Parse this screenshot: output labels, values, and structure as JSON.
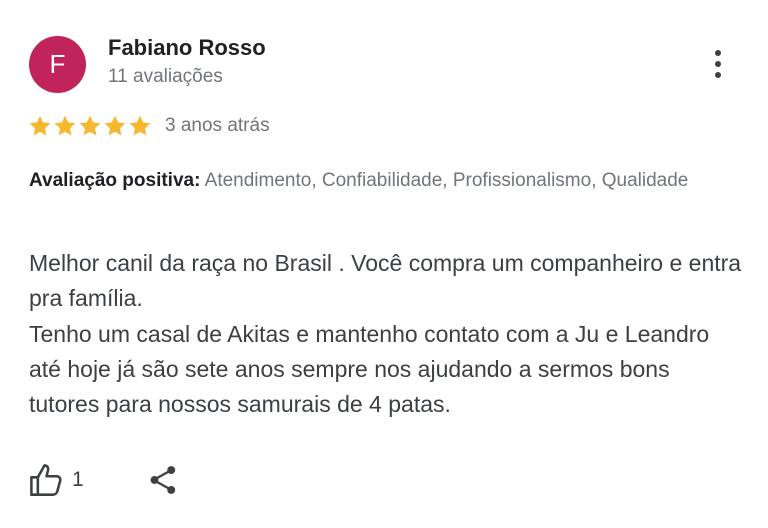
{
  "reviewer": {
    "initial": "F",
    "name": "Fabiano Rosso",
    "review_count": "11 avaliações",
    "avatar_color": "#c0245a"
  },
  "menu": {
    "icon": "more-vert-icon"
  },
  "rating": {
    "stars": 5,
    "max_stars": 5,
    "star_color": "#f5b82e",
    "date": "3 anos atrás"
  },
  "positive": {
    "label": "Avaliação positiva:",
    "text": " Atendimento, Confiabilidade, Profissionalismo, Qualidade"
  },
  "review": {
    "text": "Melhor canil da raça no Brasil . Você compra um companheiro e entra pra família.\nTenho um casal de Akitas e mantenho contato com a Ju e Leandro até hoje já são sete anos sempre nos ajudando a sermos bons tutores para nossos samurais de 4 patas."
  },
  "actions": {
    "like_icon": "thumbs-up-icon",
    "like_count": "1",
    "share_icon": "share-icon"
  }
}
